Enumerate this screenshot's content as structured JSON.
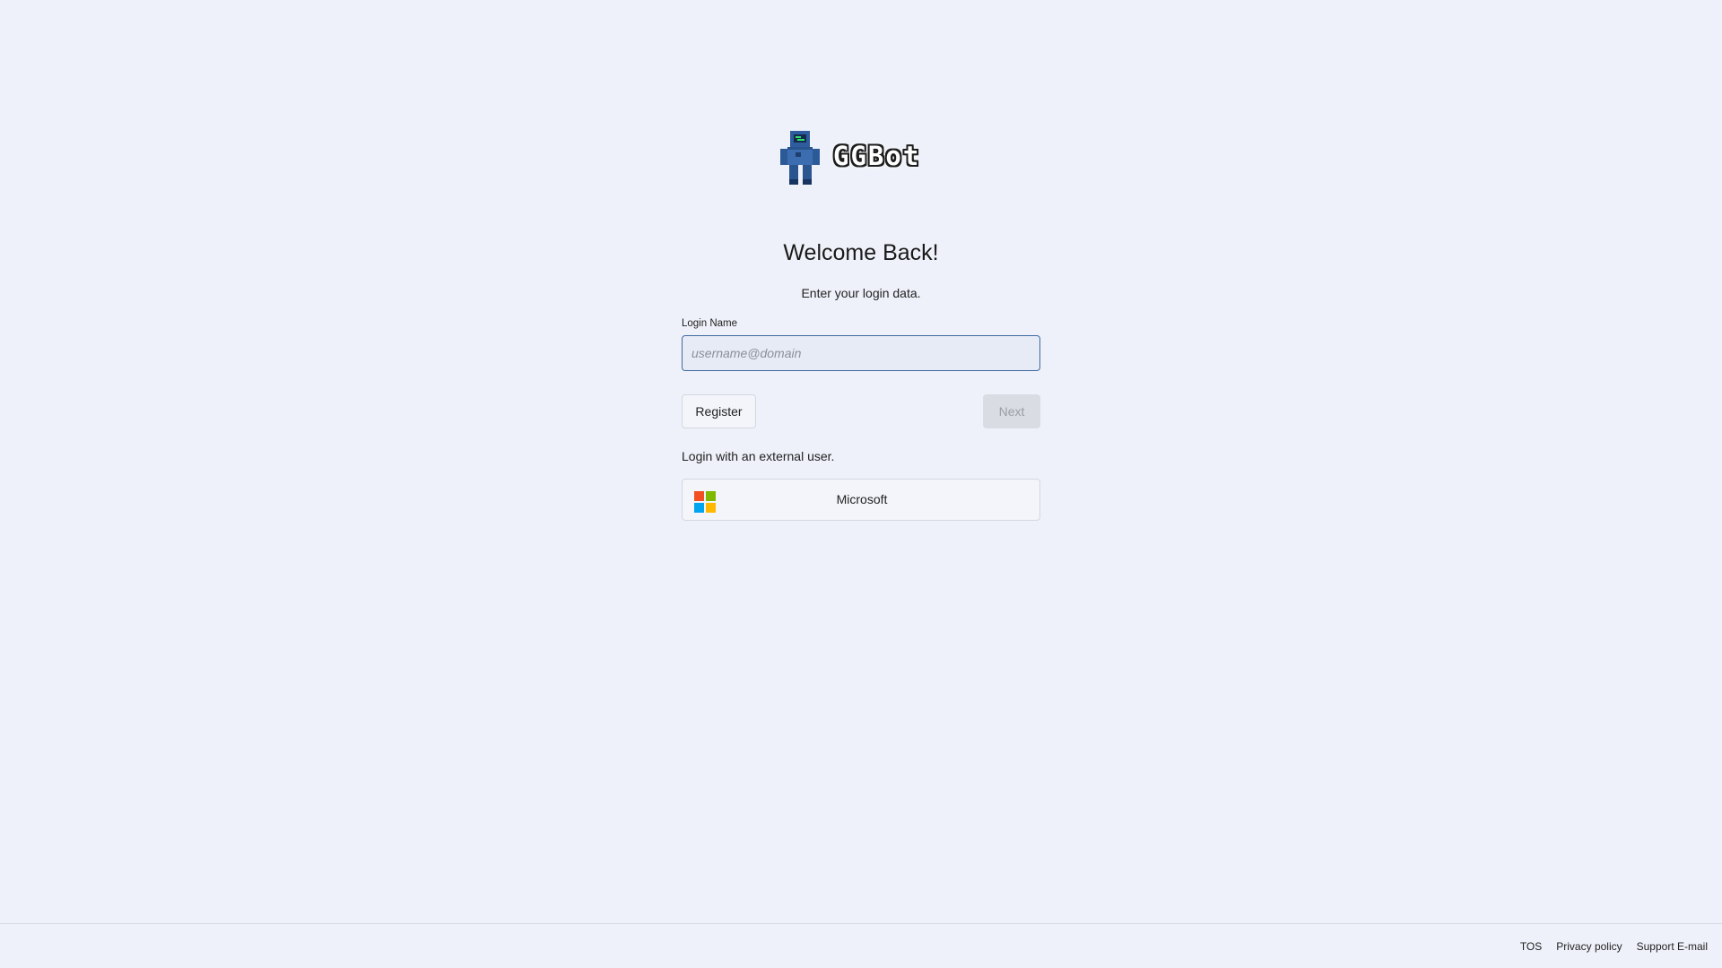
{
  "logo": {
    "text": "GGBot",
    "icon": "robot-mascot-icon"
  },
  "login": {
    "title": "Welcome Back!",
    "subtitle": "Enter your login data.",
    "field_label": "Login Name",
    "field_placeholder": "username@domain",
    "field_value": "",
    "register_label": "Register",
    "next_label": "Next",
    "external_label": "Login with an external user.",
    "microsoft_label": "Microsoft",
    "microsoft_icon": "microsoft-logo-icon"
  },
  "footer": {
    "tos": "TOS",
    "privacy": "Privacy policy",
    "support": "Support E-mail"
  },
  "colors": {
    "background": "#eef1f9",
    "input_border": "#3f6aa3",
    "ms_red": "#f25022",
    "ms_green": "#7fba00",
    "ms_blue": "#00a4ef",
    "ms_yellow": "#ffb900"
  }
}
